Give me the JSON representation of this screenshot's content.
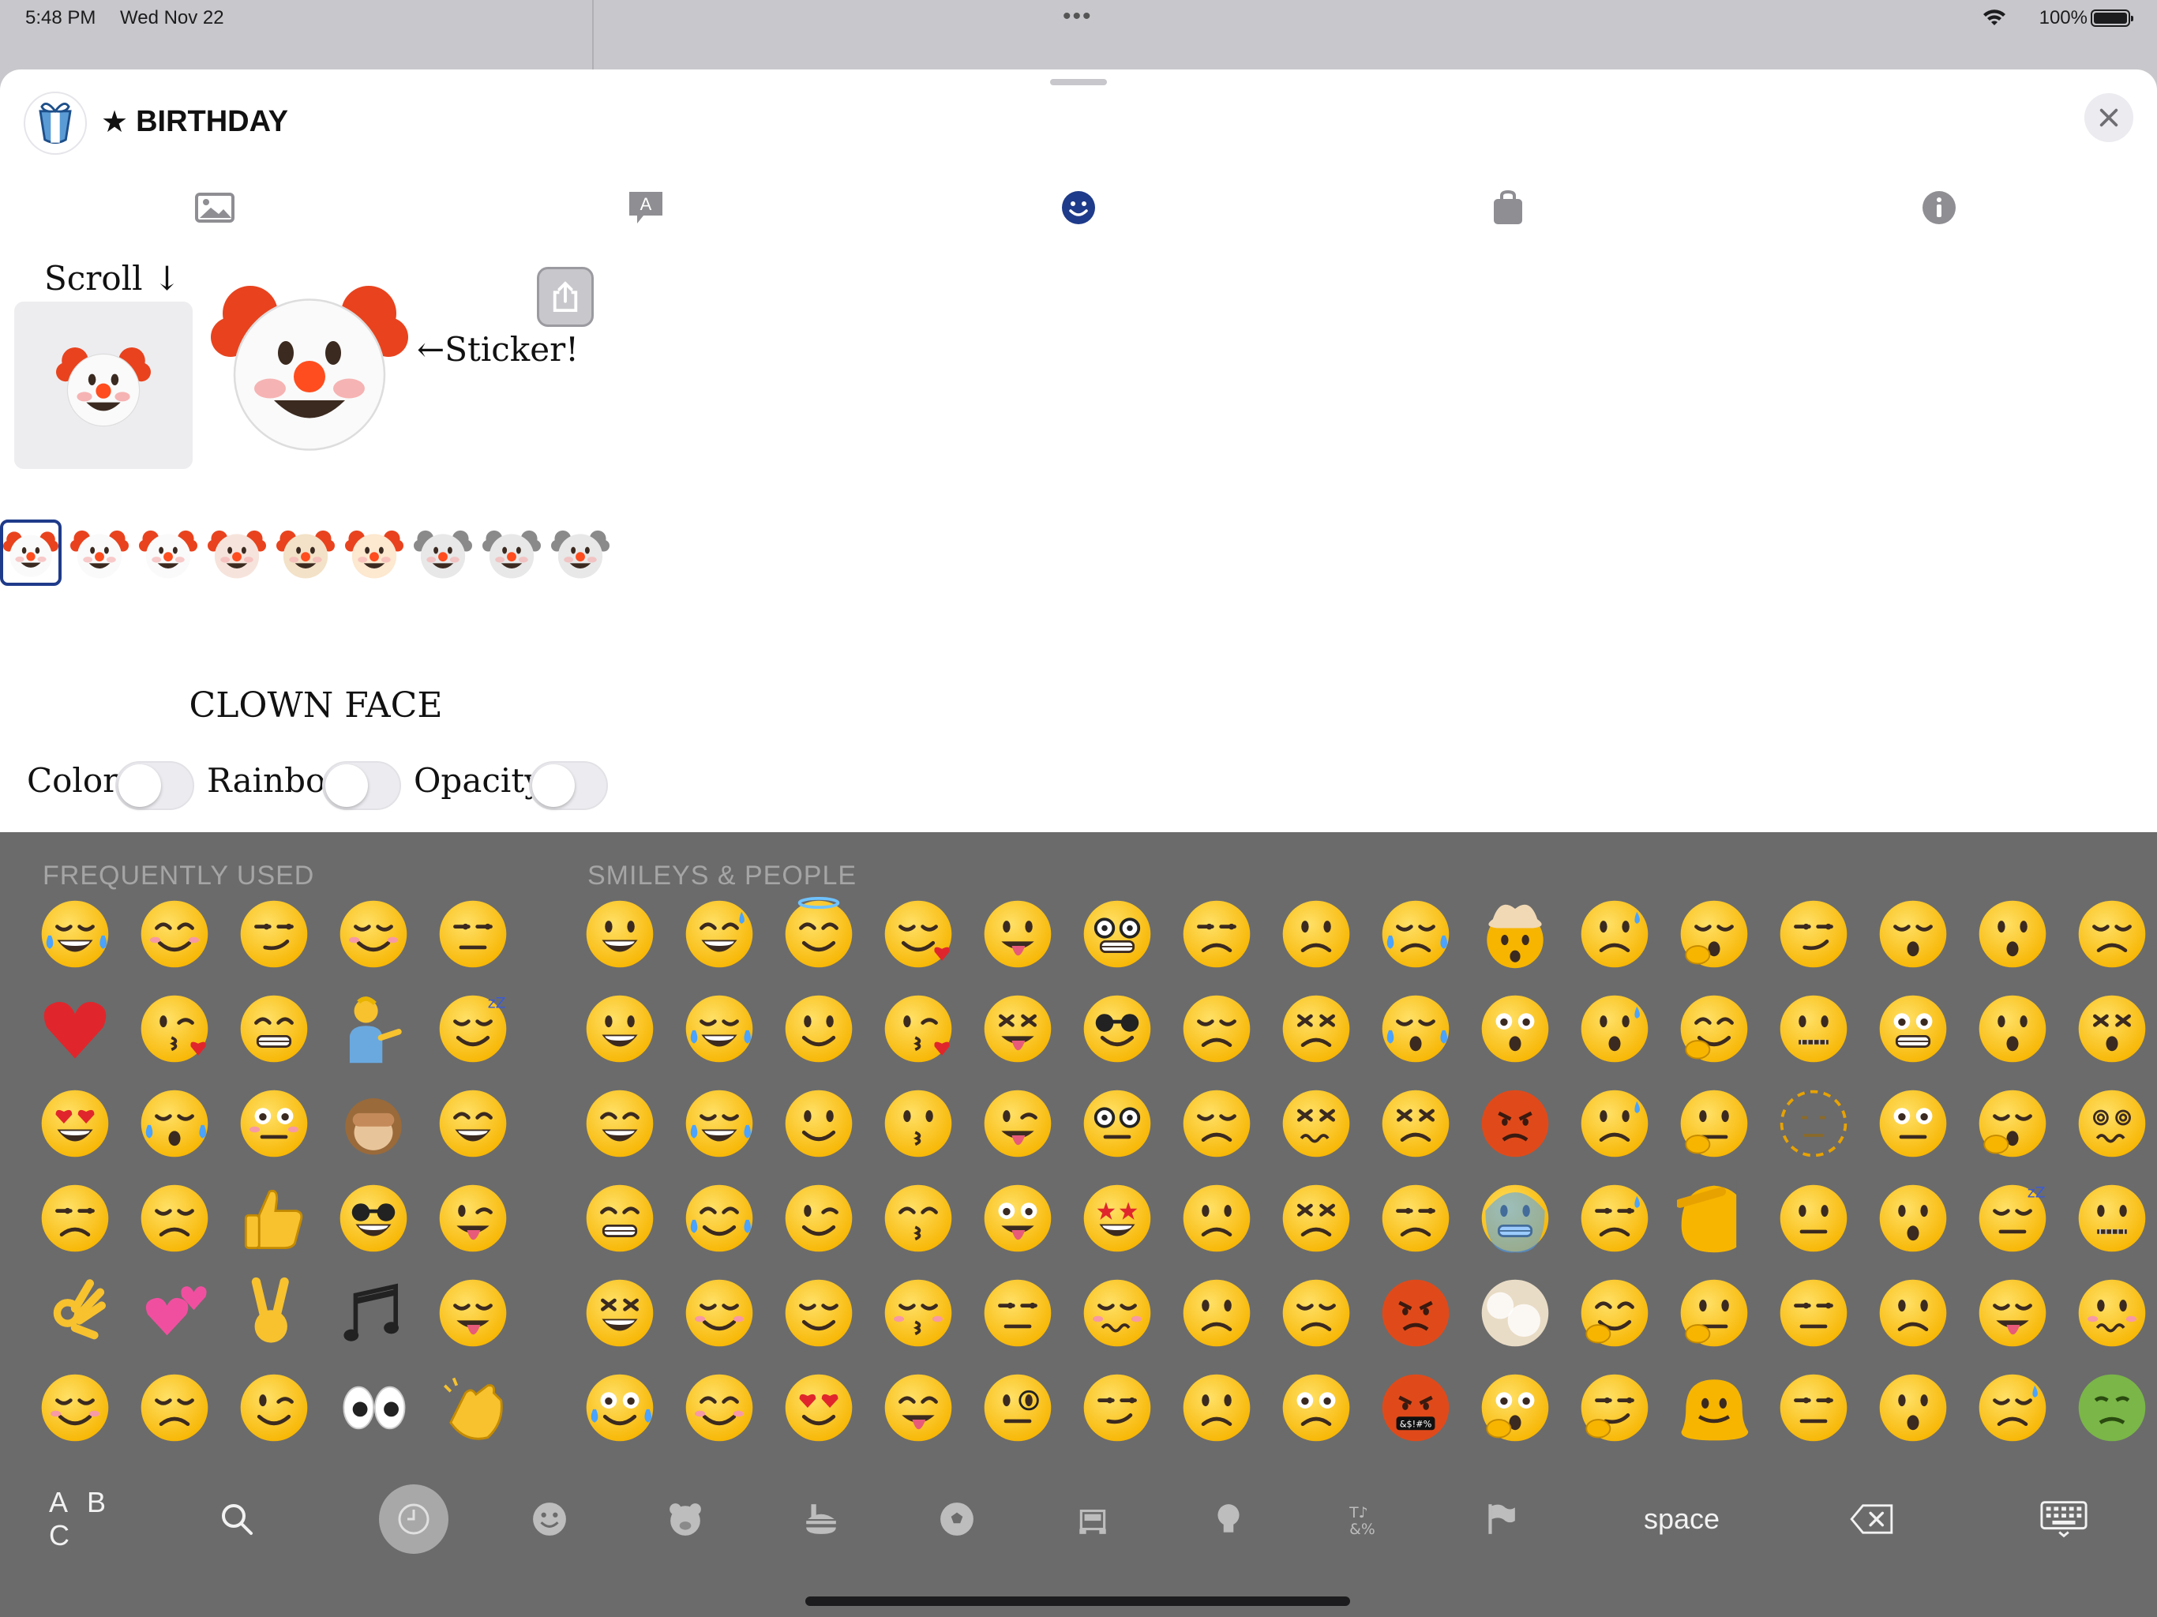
{
  "status_bar": {
    "time": "5:48 PM",
    "date": "Wed Nov 22",
    "battery": "100%"
  },
  "header": {
    "star": "★",
    "title": "BIRTHDAY"
  },
  "tabs": [
    "photo",
    "text-bubble",
    "emoji",
    "bag",
    "info"
  ],
  "tabs_active": "emoji",
  "preview": {
    "scroll_label": "Scroll ↓",
    "sticker_label": "←Sticker!",
    "selected_emoji": "CLOWN FACE"
  },
  "toggles": [
    {
      "label": "Color",
      "on": false
    },
    {
      "label": "Rainbow",
      "on": false
    },
    {
      "label": "Opacity",
      "on": false
    }
  ],
  "keyboard": {
    "frequently_used_title": "FREQUENTLY USED",
    "smileys_title": "SMILEYS & PEOPLE",
    "abc": "A B C",
    "space": "space",
    "categories": [
      "search",
      "recent",
      "smileys",
      "animals",
      "food",
      "activity",
      "travel",
      "objects",
      "symbols",
      "flags"
    ],
    "active_category": "recent",
    "colors": {
      "background": "#6b6b6b",
      "emoji_yellow": "#f7b500",
      "heart": "#e0262c"
    }
  }
}
